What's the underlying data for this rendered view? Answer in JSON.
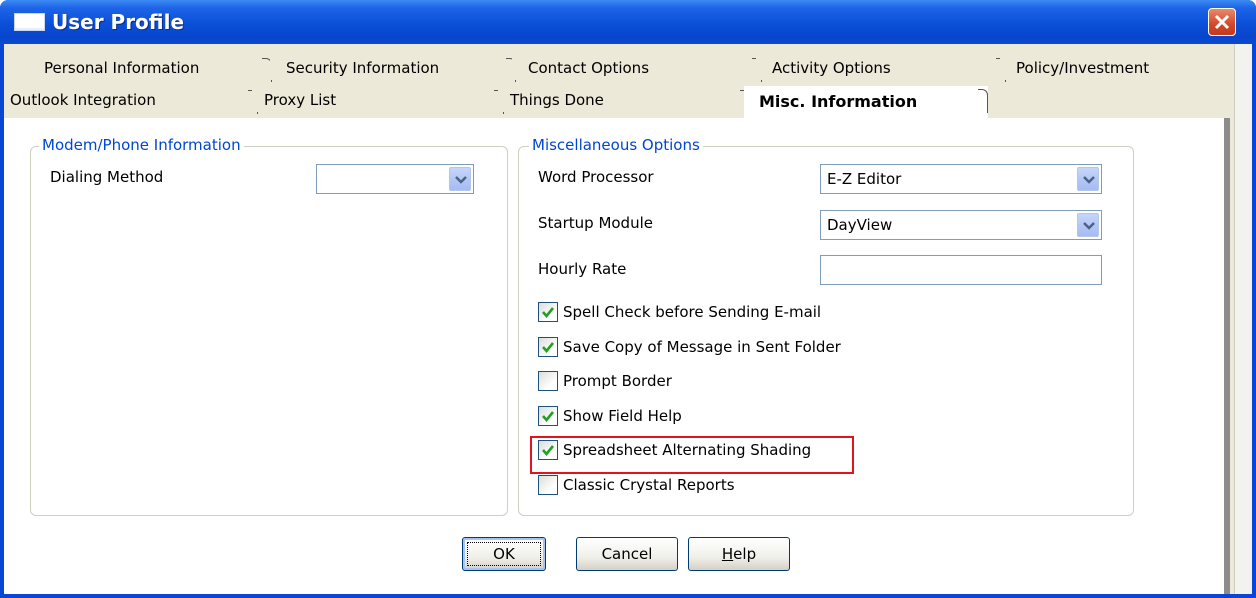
{
  "window": {
    "title": "User Profile",
    "close_label": "×"
  },
  "tabs": {
    "row1": [
      "Personal Information",
      "Security Information",
      "Contact Options",
      "Activity Options",
      "Policy/Investment"
    ],
    "row2": [
      "Outlook Integration",
      "Proxy List",
      "Things Done",
      "Misc. Information"
    ],
    "selected": "Misc. Information"
  },
  "modem_group": {
    "legend": "Modem/Phone Information",
    "dialing_method_label": "Dialing Method",
    "dialing_method_value": ""
  },
  "misc_group": {
    "legend": "Miscellaneous Options",
    "word_processor_label": "Word Processor",
    "word_processor_value": "E-Z Editor",
    "startup_module_label": "Startup Module",
    "startup_module_value": "DayView",
    "hourly_rate_label": "Hourly Rate",
    "hourly_rate_value": "",
    "checkboxes": [
      {
        "label": "Spell Check before Sending E-mail",
        "checked": true
      },
      {
        "label": "Save Copy of Message in Sent Folder",
        "checked": true
      },
      {
        "label": "Prompt Border",
        "checked": false
      },
      {
        "label": "Show Field Help",
        "checked": true
      },
      {
        "label": "Spreadsheet Alternating Shading",
        "checked": true
      },
      {
        "label": "Classic Crystal Reports",
        "checked": false
      }
    ]
  },
  "buttons": {
    "ok": "OK",
    "cancel": "Cancel",
    "help_underlined": "H",
    "help_rest": "elp"
  },
  "colors": {
    "title_bar": "#0a4fd8",
    "group_legend": "#0046d5",
    "highlight": "#e0141e",
    "check_mark": "#21a121"
  }
}
